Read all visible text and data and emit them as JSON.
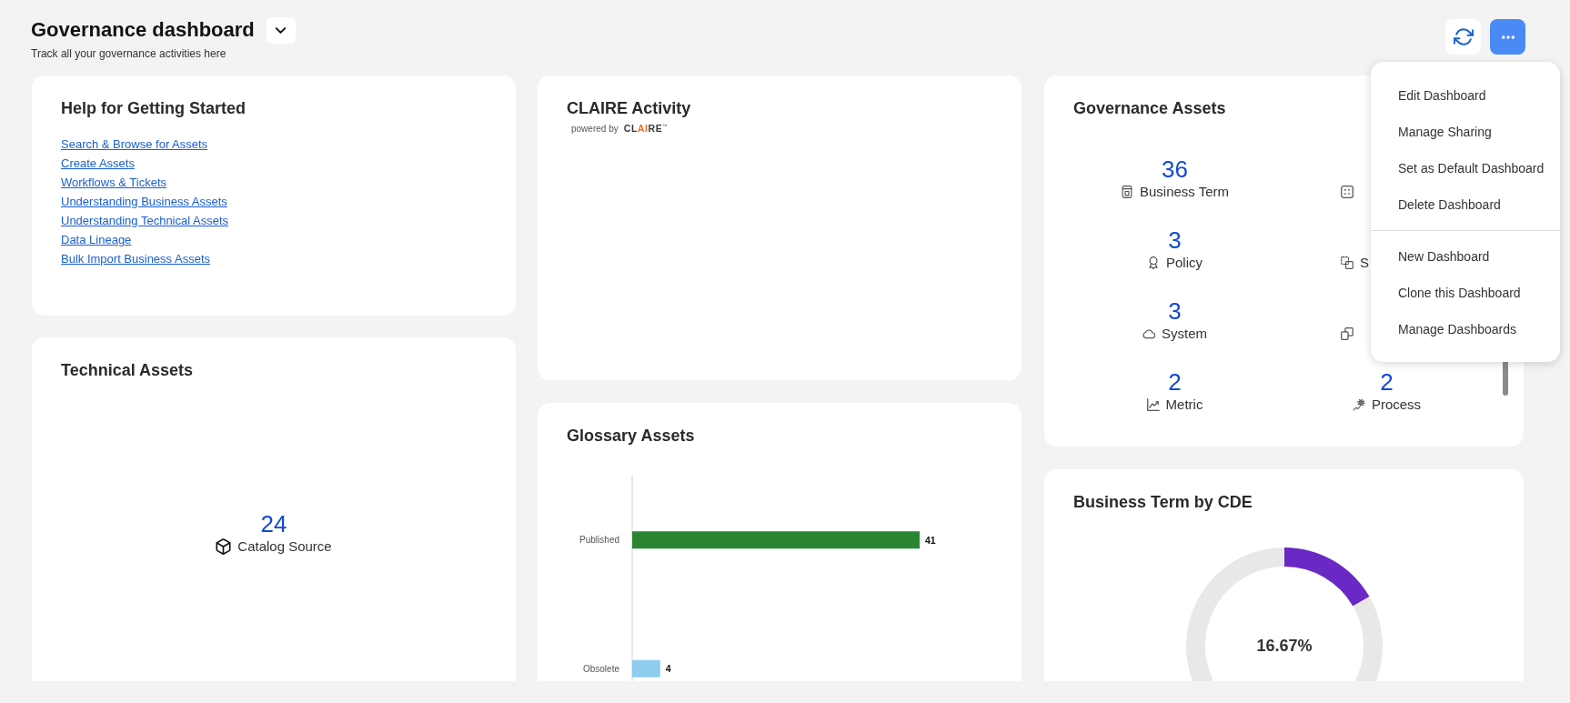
{
  "header": {
    "title": "Governance dashboard",
    "subtitle": "Track all your governance activities here",
    "dropdown": {
      "expanded": false
    }
  },
  "toolbar": {
    "more_button": {
      "expanded": true
    }
  },
  "menu": {
    "sections": [
      {
        "items": [
          "Edit Dashboard",
          "Manage Sharing",
          "Set as Default Dashboard",
          "Delete Dashboard"
        ]
      },
      {
        "items": [
          "New Dashboard",
          "Clone this Dashboard",
          "Manage Dashboards"
        ]
      }
    ]
  },
  "help_card": {
    "title": "Help for Getting Started",
    "links": [
      "Search & Browse for Assets",
      "Create Assets",
      "Workflows & Tickets",
      "Understanding Business Assets",
      "Understanding Technical Assets",
      "Data Lineage",
      "Bulk Import Business Assets"
    ]
  },
  "claire_activity": {
    "title": "CLAIRE Activity",
    "powered_by": "powered by",
    "logo": {
      "parts": [
        {
          "text": "CL",
          "accent": false
        },
        {
          "text": "AI",
          "accent": true
        },
        {
          "text": "RE",
          "accent": false
        }
      ],
      "mark": "™"
    }
  },
  "governance_assets": {
    "title": "Governance Assets",
    "items": [
      {
        "kind": "term",
        "count": "36",
        "label": "Business Term"
      },
      {
        "kind": "grid"
      },
      {
        "kind": "policy",
        "count": "3",
        "label": "Policy"
      },
      {
        "kind": "overlap",
        "label": "S"
      },
      {
        "kind": "cloud",
        "count": "3",
        "label": "System"
      },
      {
        "kind": "copies"
      },
      {
        "kind": "metric",
        "count": "2",
        "label": "Metric"
      },
      {
        "kind": "process",
        "count": "2",
        "label": "Process"
      }
    ]
  },
  "technical_assets": {
    "title": "Technical Assets",
    "items": [
      {
        "kind": "cube",
        "count": "24",
        "label": "Catalog Source"
      }
    ]
  },
  "glossary_assets": {
    "title": "Glossary Assets",
    "chart_data": {
      "type": "bar",
      "orientation": "horizontal",
      "categories": [
        "Published",
        "Obsolete"
      ],
      "series": [
        {
          "color": "#2a8532",
          "values": [
            41,
            null
          ]
        },
        {
          "color": "#8fcdee",
          "values": [
            null,
            4
          ]
        }
      ],
      "stacked": true,
      "data_labels": true
    }
  },
  "business_term_by_cde": {
    "title": "Business Term by CDE",
    "center_label": "16.67%",
    "slices": [
      {
        "color": "#6a28c4"
      },
      {
        "color": "#e8e8e8"
      }
    ],
    "chart_data": {
      "type": "donut",
      "values": [
        16.67,
        83.33
      ]
    }
  }
}
